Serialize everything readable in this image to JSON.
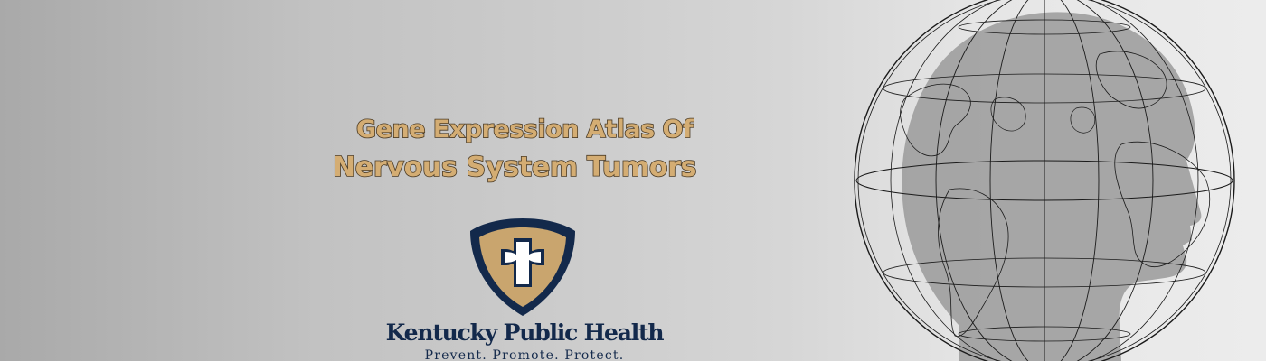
{
  "banner": {
    "title_line1": "Gene Expression Atlas Of",
    "title_line2": "Nervous System Tumors"
  },
  "logo": {
    "org_name": "Kentucky Public Health",
    "tagline": "Prevent. Promote. Protect.",
    "icon": "shield-cross-icon"
  },
  "illustration": {
    "icon": "globe-head-icon"
  },
  "colors": {
    "title_fill": "#d4ad73",
    "title_outline": "#4a3a24",
    "brand_navy": "#13294b",
    "brand_gold": "#c9a56e"
  }
}
